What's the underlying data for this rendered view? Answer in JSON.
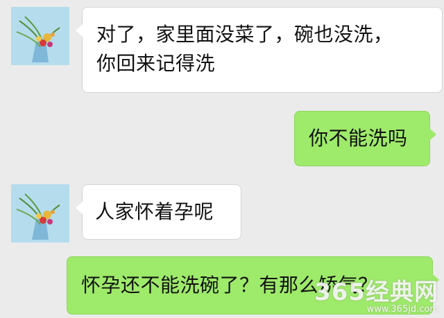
{
  "messages": [
    {
      "side": "left",
      "text": "对了，家里面没菜了，碗也没洗，你回来记得洗",
      "line1": "对了，家里面没菜了，碗也没洗，",
      "line2": "你回来记得洗"
    },
    {
      "side": "right",
      "text": "你不能洗吗"
    },
    {
      "side": "left",
      "text": "人家怀着孕呢"
    },
    {
      "side": "right",
      "text": "怀孕还不能洗碗了？有那么矫气？"
    }
  ],
  "avatar": {
    "icon": "flower-bouquet-icon"
  },
  "watermark": {
    "main": "365经典网",
    "sub": "www.365jd.com"
  },
  "colors": {
    "background": "#ebebeb",
    "incoming_bubble": "#ffffff",
    "outgoing_bubble": "#9eea6a"
  }
}
